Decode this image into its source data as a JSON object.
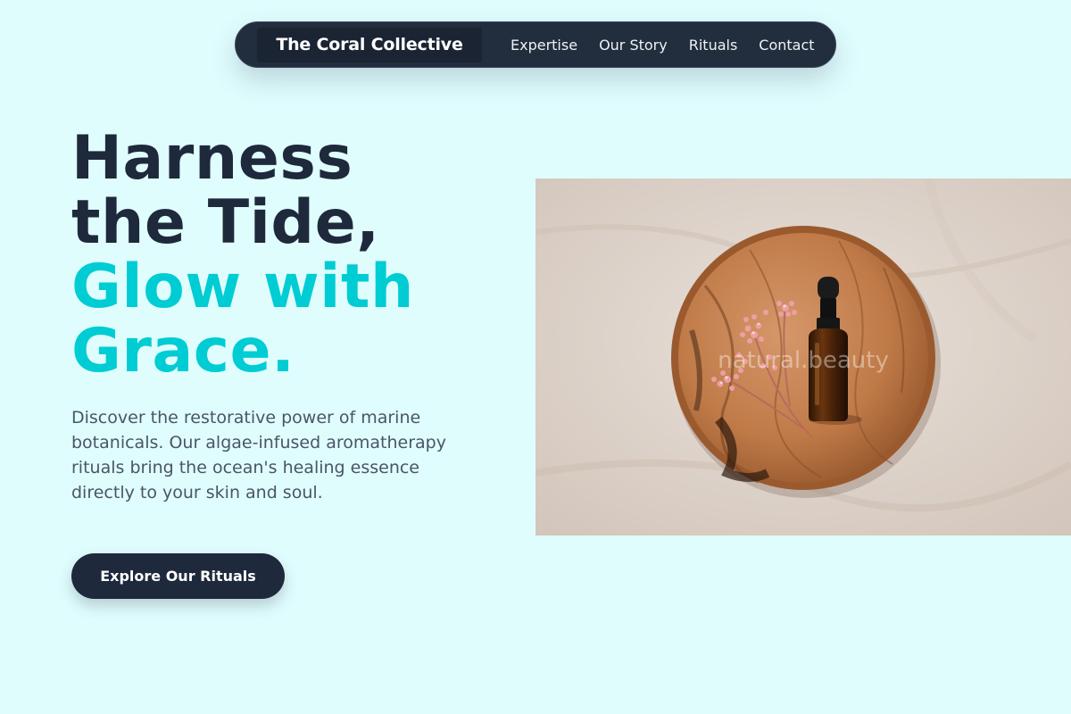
{
  "nav": {
    "brand": "The Coral Collective",
    "links": [
      "Expertise",
      "Our Story",
      "Rituals",
      "Contact"
    ]
  },
  "hero": {
    "headline_line1": "Harness",
    "headline_line2": "the Tide,",
    "headline_accent_line1": "Glow with",
    "headline_accent_line2": "Grace.",
    "description": "Discover the restorative power of marine botanicals. Our algae-infused aromatherapy rituals bring the ocean's healing essence directly to your skin and soul.",
    "cta_label": "Explore Our Rituals",
    "image_watermark": "natural.beauty"
  },
  "colors": {
    "background": "#e0fdfe",
    "dark": "#1e293b",
    "accent": "#00ccd3",
    "body_text": "#4a5565"
  }
}
